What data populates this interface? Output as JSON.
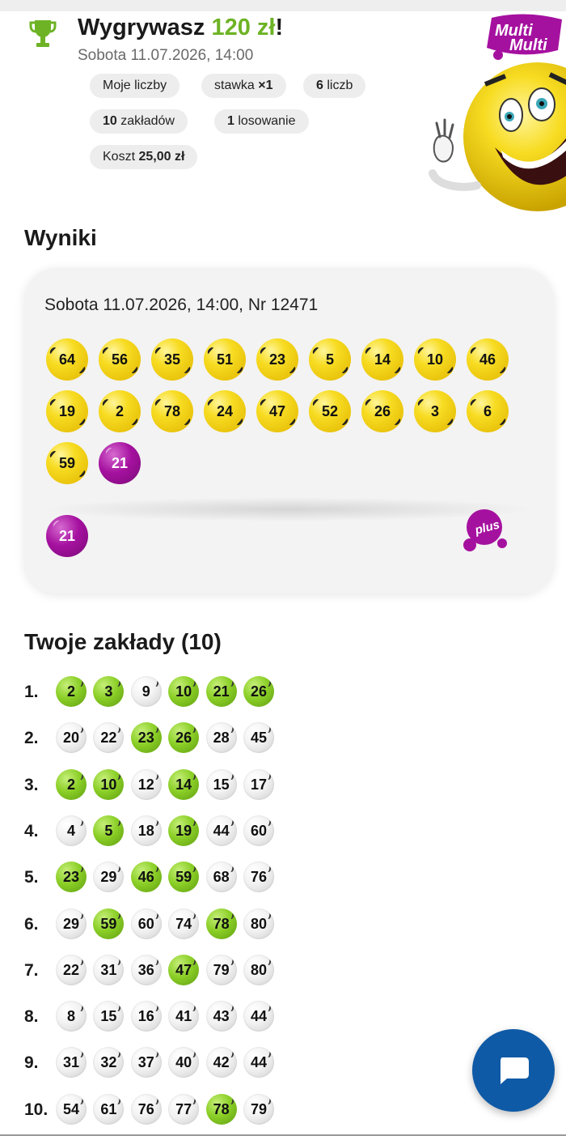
{
  "header": {
    "title_prefix": "Wygrywasz ",
    "amount": "120 zł",
    "title_suffix": "!",
    "date": "Sobota 11.07.2026, 14:00",
    "chips": {
      "my_numbers": "Moje liczby",
      "stake_label": "stawka ",
      "stake_value": "×1",
      "count_value": "6",
      "count_label": " liczb",
      "bets_value": "10",
      "bets_label": " zakładów",
      "draws_value": "1",
      "draws_label": " losowanie",
      "cost_label": "Koszt ",
      "cost_value": "25,00 zł"
    },
    "logo_text_1": "Multi",
    "logo_text_2": "Multi"
  },
  "results": {
    "title": "Wyniki",
    "draw_info": "Sobota 11.07.2026, 14:00, Nr 12471",
    "numbers": [
      "64",
      "56",
      "35",
      "51",
      "23",
      "5",
      "14",
      "10",
      "46",
      "19",
      "2",
      "78",
      "24",
      "47",
      "52",
      "26",
      "3",
      "6",
      "59"
    ],
    "multi_number": "21",
    "plus_number": "21",
    "plus_logo_text": "plus"
  },
  "bets": {
    "title": "Twoje zakłady (10)",
    "rows": [
      {
        "label": "1.",
        "numbers": [
          "2",
          "3",
          "9",
          "10",
          "21",
          "26"
        ],
        "hits": [
          true,
          true,
          false,
          true,
          true,
          true
        ]
      },
      {
        "label": "2.",
        "numbers": [
          "20",
          "22",
          "23",
          "26",
          "28",
          "45"
        ],
        "hits": [
          false,
          false,
          true,
          true,
          false,
          false
        ]
      },
      {
        "label": "3.",
        "numbers": [
          "2",
          "10",
          "12",
          "14",
          "15",
          "17"
        ],
        "hits": [
          true,
          true,
          false,
          true,
          false,
          false
        ]
      },
      {
        "label": "4.",
        "numbers": [
          "4",
          "5",
          "18",
          "19",
          "44",
          "60"
        ],
        "hits": [
          false,
          true,
          false,
          true,
          false,
          false
        ]
      },
      {
        "label": "5.",
        "numbers": [
          "23",
          "29",
          "46",
          "59",
          "68",
          "76"
        ],
        "hits": [
          true,
          false,
          true,
          true,
          false,
          false
        ]
      },
      {
        "label": "6.",
        "numbers": [
          "29",
          "59",
          "60",
          "74",
          "78",
          "80"
        ],
        "hits": [
          false,
          true,
          false,
          false,
          true,
          false
        ]
      },
      {
        "label": "7.",
        "numbers": [
          "22",
          "31",
          "36",
          "47",
          "79",
          "80"
        ],
        "hits": [
          false,
          false,
          false,
          true,
          false,
          false
        ]
      },
      {
        "label": "8.",
        "numbers": [
          "8",
          "15",
          "16",
          "41",
          "43",
          "44"
        ],
        "hits": [
          false,
          false,
          false,
          false,
          false,
          false
        ]
      },
      {
        "label": "9.",
        "numbers": [
          "31",
          "32",
          "37",
          "40",
          "42",
          "44"
        ],
        "hits": [
          false,
          false,
          false,
          false,
          false,
          false
        ]
      },
      {
        "label": "10.",
        "numbers": [
          "54",
          "61",
          "76",
          "77",
          "78",
          "79"
        ],
        "hits": [
          false,
          false,
          false,
          false,
          true,
          false
        ]
      }
    ]
  },
  "colors": {
    "accent_green": "#6db325",
    "ball_yellow": "#f7dc22",
    "ball_purple": "#a5119f",
    "hit_green": "#8bcf27",
    "fab_blue": "#0f5aa6"
  },
  "icons": {
    "trophy": "trophy-icon",
    "chat": "chat-bubble-icon"
  }
}
